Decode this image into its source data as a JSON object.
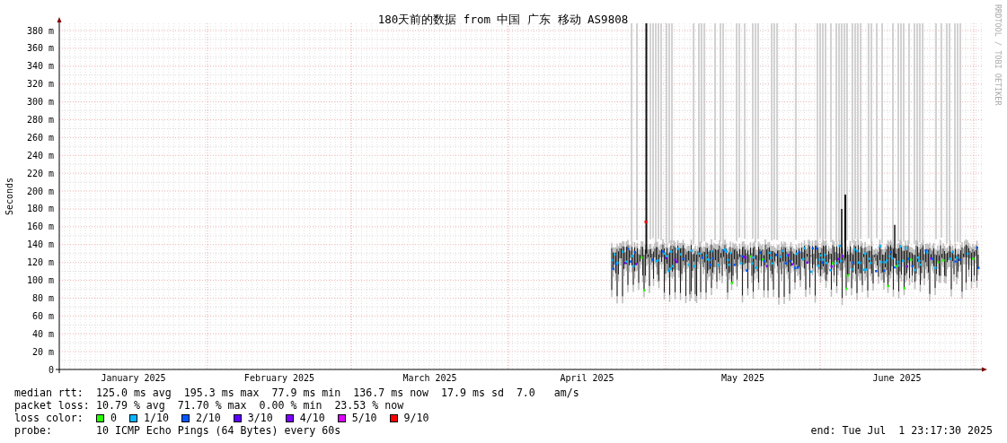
{
  "title": "180天前的数据 from 中国 广东 移动 AS9808",
  "credit": "RRDTOOL / TOBI OETIKER",
  "y_axis": {
    "label": "Seconds",
    "ticks": [
      "380 m",
      "360 m",
      "340 m",
      "320 m",
      "300 m",
      "280 m",
      "260 m",
      "240 m",
      "220 m",
      "200 m",
      "180 m",
      "160 m",
      "140 m",
      "120 m",
      "100 m",
      "80 m",
      "60 m",
      "40 m",
      "20 m",
      "0"
    ]
  },
  "x_axis": {
    "months": [
      "January 2025",
      "February 2025",
      "March 2025",
      "April 2025",
      "May 2025",
      "June 2025"
    ]
  },
  "stats": [
    {
      "label": "median rtt:",
      "values": [
        "125.0 ms avg",
        "195.3 ms max",
        "77.9 ms min",
        "136.7 ms now",
        "17.9 ms sd",
        "7.0   am/s"
      ]
    },
    {
      "label": "packet loss:",
      "values": [
        "10.79 % avg",
        "71.70 % max",
        "0.00 % min",
        "23.53 % now"
      ]
    }
  ],
  "loss_color": {
    "label": "loss color:",
    "items": [
      {
        "label": "0",
        "color": "#26ff00"
      },
      {
        "label": "1/10",
        "color": "#00b8ff"
      },
      {
        "label": "2/10",
        "color": "#0059ff"
      },
      {
        "label": "3/10",
        "color": "#5e00ff"
      },
      {
        "label": "4/10",
        "color": "#7e00ff"
      },
      {
        "label": "5/10",
        "color": "#dd00ff"
      },
      {
        "label": "9/10",
        "color": "#ff0000"
      }
    ]
  },
  "probe": {
    "label": "probe:",
    "value": "10 ICMP Echo Pings (64 Bytes) every 60s"
  },
  "end": "end: Tue Jul  1 23:17:30 2025"
}
